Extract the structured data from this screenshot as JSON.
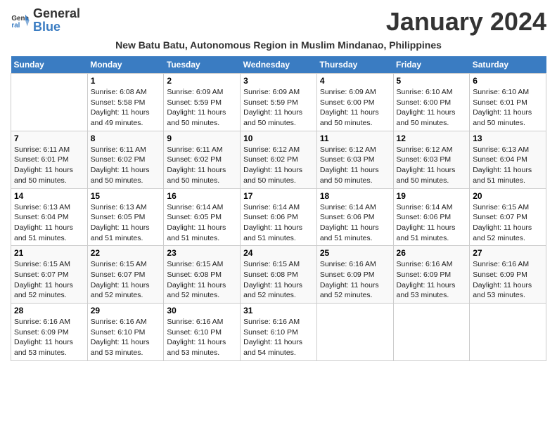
{
  "logo": {
    "general": "General",
    "blue": "Blue"
  },
  "title": "January 2024",
  "subtitle": "New Batu Batu, Autonomous Region in Muslim Mindanao, Philippines",
  "days_header": [
    "Sunday",
    "Monday",
    "Tuesday",
    "Wednesday",
    "Thursday",
    "Friday",
    "Saturday"
  ],
  "weeks": [
    [
      {
        "num": "",
        "info": ""
      },
      {
        "num": "1",
        "info": "Sunrise: 6:08 AM\nSunset: 5:58 PM\nDaylight: 11 hours\nand 49 minutes."
      },
      {
        "num": "2",
        "info": "Sunrise: 6:09 AM\nSunset: 5:59 PM\nDaylight: 11 hours\nand 50 minutes."
      },
      {
        "num": "3",
        "info": "Sunrise: 6:09 AM\nSunset: 5:59 PM\nDaylight: 11 hours\nand 50 minutes."
      },
      {
        "num": "4",
        "info": "Sunrise: 6:09 AM\nSunset: 6:00 PM\nDaylight: 11 hours\nand 50 minutes."
      },
      {
        "num": "5",
        "info": "Sunrise: 6:10 AM\nSunset: 6:00 PM\nDaylight: 11 hours\nand 50 minutes."
      },
      {
        "num": "6",
        "info": "Sunrise: 6:10 AM\nSunset: 6:01 PM\nDaylight: 11 hours\nand 50 minutes."
      }
    ],
    [
      {
        "num": "7",
        "info": "Sunrise: 6:11 AM\nSunset: 6:01 PM\nDaylight: 11 hours\nand 50 minutes."
      },
      {
        "num": "8",
        "info": "Sunrise: 6:11 AM\nSunset: 6:02 PM\nDaylight: 11 hours\nand 50 minutes."
      },
      {
        "num": "9",
        "info": "Sunrise: 6:11 AM\nSunset: 6:02 PM\nDaylight: 11 hours\nand 50 minutes."
      },
      {
        "num": "10",
        "info": "Sunrise: 6:12 AM\nSunset: 6:02 PM\nDaylight: 11 hours\nand 50 minutes."
      },
      {
        "num": "11",
        "info": "Sunrise: 6:12 AM\nSunset: 6:03 PM\nDaylight: 11 hours\nand 50 minutes."
      },
      {
        "num": "12",
        "info": "Sunrise: 6:12 AM\nSunset: 6:03 PM\nDaylight: 11 hours\nand 50 minutes."
      },
      {
        "num": "13",
        "info": "Sunrise: 6:13 AM\nSunset: 6:04 PM\nDaylight: 11 hours\nand 51 minutes."
      }
    ],
    [
      {
        "num": "14",
        "info": "Sunrise: 6:13 AM\nSunset: 6:04 PM\nDaylight: 11 hours\nand 51 minutes."
      },
      {
        "num": "15",
        "info": "Sunrise: 6:13 AM\nSunset: 6:05 PM\nDaylight: 11 hours\nand 51 minutes."
      },
      {
        "num": "16",
        "info": "Sunrise: 6:14 AM\nSunset: 6:05 PM\nDaylight: 11 hours\nand 51 minutes."
      },
      {
        "num": "17",
        "info": "Sunrise: 6:14 AM\nSunset: 6:06 PM\nDaylight: 11 hours\nand 51 minutes."
      },
      {
        "num": "18",
        "info": "Sunrise: 6:14 AM\nSunset: 6:06 PM\nDaylight: 11 hours\nand 51 minutes."
      },
      {
        "num": "19",
        "info": "Sunrise: 6:14 AM\nSunset: 6:06 PM\nDaylight: 11 hours\nand 51 minutes."
      },
      {
        "num": "20",
        "info": "Sunrise: 6:15 AM\nSunset: 6:07 PM\nDaylight: 11 hours\nand 52 minutes."
      }
    ],
    [
      {
        "num": "21",
        "info": "Sunrise: 6:15 AM\nSunset: 6:07 PM\nDaylight: 11 hours\nand 52 minutes."
      },
      {
        "num": "22",
        "info": "Sunrise: 6:15 AM\nSunset: 6:07 PM\nDaylight: 11 hours\nand 52 minutes."
      },
      {
        "num": "23",
        "info": "Sunrise: 6:15 AM\nSunset: 6:08 PM\nDaylight: 11 hours\nand 52 minutes."
      },
      {
        "num": "24",
        "info": "Sunrise: 6:15 AM\nSunset: 6:08 PM\nDaylight: 11 hours\nand 52 minutes."
      },
      {
        "num": "25",
        "info": "Sunrise: 6:16 AM\nSunset: 6:09 PM\nDaylight: 11 hours\nand 52 minutes."
      },
      {
        "num": "26",
        "info": "Sunrise: 6:16 AM\nSunset: 6:09 PM\nDaylight: 11 hours\nand 53 minutes."
      },
      {
        "num": "27",
        "info": "Sunrise: 6:16 AM\nSunset: 6:09 PM\nDaylight: 11 hours\nand 53 minutes."
      }
    ],
    [
      {
        "num": "28",
        "info": "Sunrise: 6:16 AM\nSunset: 6:09 PM\nDaylight: 11 hours\nand 53 minutes."
      },
      {
        "num": "29",
        "info": "Sunrise: 6:16 AM\nSunset: 6:10 PM\nDaylight: 11 hours\nand 53 minutes."
      },
      {
        "num": "30",
        "info": "Sunrise: 6:16 AM\nSunset: 6:10 PM\nDaylight: 11 hours\nand 53 minutes."
      },
      {
        "num": "31",
        "info": "Sunrise: 6:16 AM\nSunset: 6:10 PM\nDaylight: 11 hours\nand 54 minutes."
      },
      {
        "num": "",
        "info": ""
      },
      {
        "num": "",
        "info": ""
      },
      {
        "num": "",
        "info": ""
      }
    ]
  ]
}
